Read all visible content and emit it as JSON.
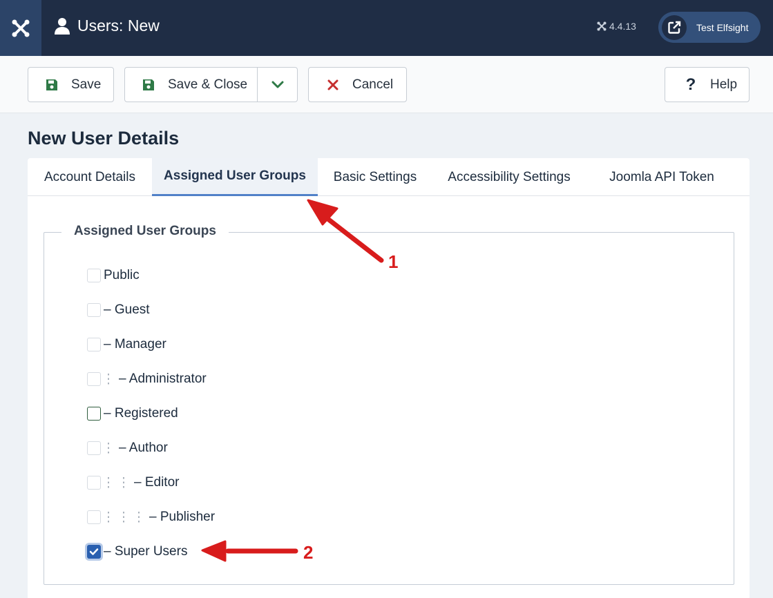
{
  "header": {
    "title": "Users: New",
    "version": "4.4.13",
    "user_name": "Test Elfsight"
  },
  "toolbar": {
    "save_label": "Save",
    "save_close_label": "Save & Close",
    "cancel_label": "Cancel",
    "help_label": "Help"
  },
  "page": {
    "section_title": "New User Details"
  },
  "tabs": [
    {
      "label": "Account Details"
    },
    {
      "label": "Assigned User Groups"
    },
    {
      "label": "Basic Settings"
    },
    {
      "label": "Accessibility Settings"
    },
    {
      "label": "Joomla API Token"
    }
  ],
  "fieldset": {
    "legend": "Assigned User Groups"
  },
  "groups": [
    {
      "label": "Public",
      "checked": false
    },
    {
      "label": "– Guest",
      "checked": false
    },
    {
      "label": "– Manager",
      "checked": false
    },
    {
      "label": "– Administrator",
      "checked": false
    },
    {
      "label": "– Registered",
      "checked": false
    },
    {
      "label": "– Author",
      "checked": false
    },
    {
      "label": "– Editor",
      "checked": false
    },
    {
      "label": "– Publisher",
      "checked": false
    },
    {
      "label": "– Super Users",
      "checked": true
    }
  ],
  "annotations": {
    "marker_1": "1",
    "marker_2": "2"
  },
  "colors": {
    "header_bg": "#1f2d45",
    "accent_blue": "#2a60b0",
    "save_green": "#2f7a47",
    "cancel_red": "#c52f2f",
    "annotation_red": "#d81c1c"
  }
}
